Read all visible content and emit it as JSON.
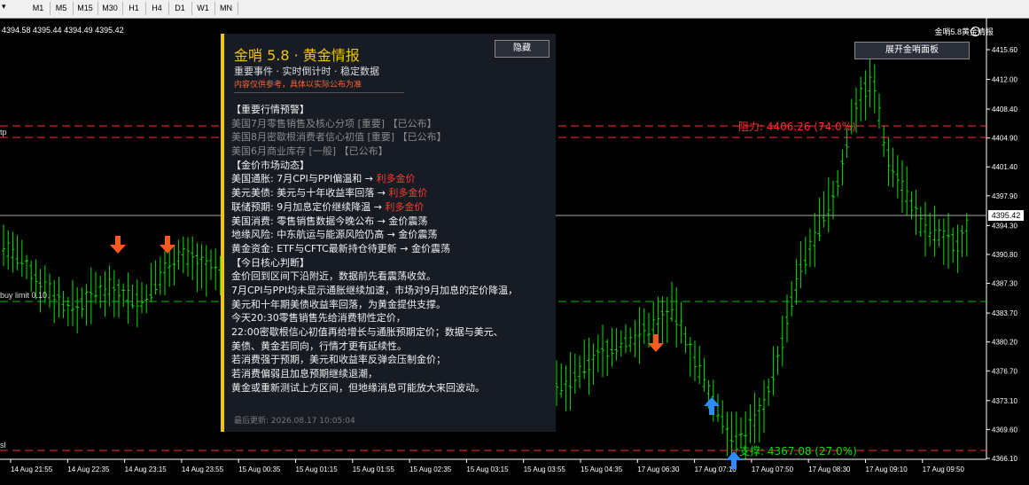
{
  "toolbar": {
    "timeframes": [
      "M1",
      "M5",
      "M15",
      "M30",
      "H1",
      "H4",
      "D1",
      "W1",
      "MN"
    ]
  },
  "chart_header": {
    "ohlc": "4394.58 4395.44 4394.49 4395.42",
    "title": "金哨5.8黄金情报"
  },
  "chart_labels": {
    "tp": "tp",
    "buy_limit": "buy limit 0.10",
    "sl": "sl"
  },
  "price_axis": {
    "ticks": [
      "4415.60",
      "4412.00",
      "4408.40",
      "4404.90",
      "4401.40",
      "4397.90",
      "4394.30",
      "4390.80",
      "4387.30",
      "4383.70",
      "4380.20",
      "4376.70",
      "4373.10",
      "4369.60",
      "4366.10"
    ],
    "current": "4395.42"
  },
  "time_axis": {
    "ticks": [
      "14 Aug 21:55",
      "14 Aug 22:35",
      "14 Aug 23:15",
      "14 Aug 23:55",
      "15 Aug 00:35",
      "15 Aug 01:15",
      "15 Aug 01:55",
      "15 Aug 02:35",
      "15 Aug 03:15",
      "15 Aug 03:55",
      "15 Aug 04:35",
      "17 Aug 06:30",
      "17 Aug 07:10",
      "17 Aug 07:50",
      "17 Aug 08:30",
      "17 Aug 09:10",
      "17 Aug 09:50"
    ]
  },
  "levels": {
    "resistance": "阻力: 4406.26 (74.0%)",
    "support": "支撑: 4367.08 (27.0%)"
  },
  "buttons": {
    "expand": "展开金哨面板",
    "hide": "隐藏"
  },
  "panel": {
    "title": "金哨 5.8 · 黄金情报",
    "subtitle": "重要事件 · 实时倒计时 · 稳定数据",
    "warning": "内容仅供参考，具体以实际公布为准",
    "sec_alerts": "【重要行情预警】",
    "alerts": [
      "美国7月零售销售及核心分项 [重要] 【已公布】",
      "美国8月密歇根消费者信心初值 [重要] 【已公布】",
      "美国6月商业库存 [一般] 【已公布】"
    ],
    "sec_market": "【金价市场动态】",
    "market": [
      {
        "label": "美国通胀: 7月CPI与PPI偏温和",
        "arrow": "→",
        "result": "利多金价",
        "color": "red"
      },
      {
        "label": "美元美债: 美元与十年收益率回落",
        "arrow": "→",
        "result": "利多金价",
        "color": "red"
      },
      {
        "label": "联储预期: 9月加息定价继续降温",
        "arrow": "→",
        "result": "利多金价",
        "color": "red"
      },
      {
        "label": "美国消费: 零售销售数据今晚公布",
        "arrow": "→",
        "result": "金价震荡",
        "color": "gold"
      },
      {
        "label": "地缘风险: 中东航运与能源风险仍高",
        "arrow": "→",
        "result": "金价震荡",
        "color": "gold"
      },
      {
        "label": "黄金资金: ETF与CFTC最新持仓待更新",
        "arrow": "→",
        "result": "金价震荡",
        "color": "gold"
      }
    ],
    "sec_judgement": "【今日核心判断】",
    "judgement": [
      "金价回到区间下沿附近，数据前先看震荡收敛。",
      "7月CPI与PPI均未显示通胀继续加速，市场对9月加息的定价降温，",
      "美元和十年期美债收益率回落，为黄金提供支撑。",
      "今天20:30零售销售先给消费韧性定价，",
      "22:00密歇根信心初值再给增长与通胀预期定价；数据与美元、",
      "美债、黄金若同向，行情才更有延续性。",
      "若消费强于预期，美元和收益率反弹会压制金价；",
      "若消费偏弱且加息预期继续退潮，",
      "黄金或重新测试上方区间，但地缘消息可能放大来回波动。"
    ],
    "footer": "最后更新: 2026.08.17 10:05:04"
  },
  "colors": {
    "up_candle": "#00e000",
    "grid_line": "#00c000",
    "resistance": "#ff3030",
    "support": "#00e000",
    "panel_accent": "#f2c500",
    "sell_arrow": "#ff5a1e",
    "buy_arrow": "#2d8cff"
  }
}
